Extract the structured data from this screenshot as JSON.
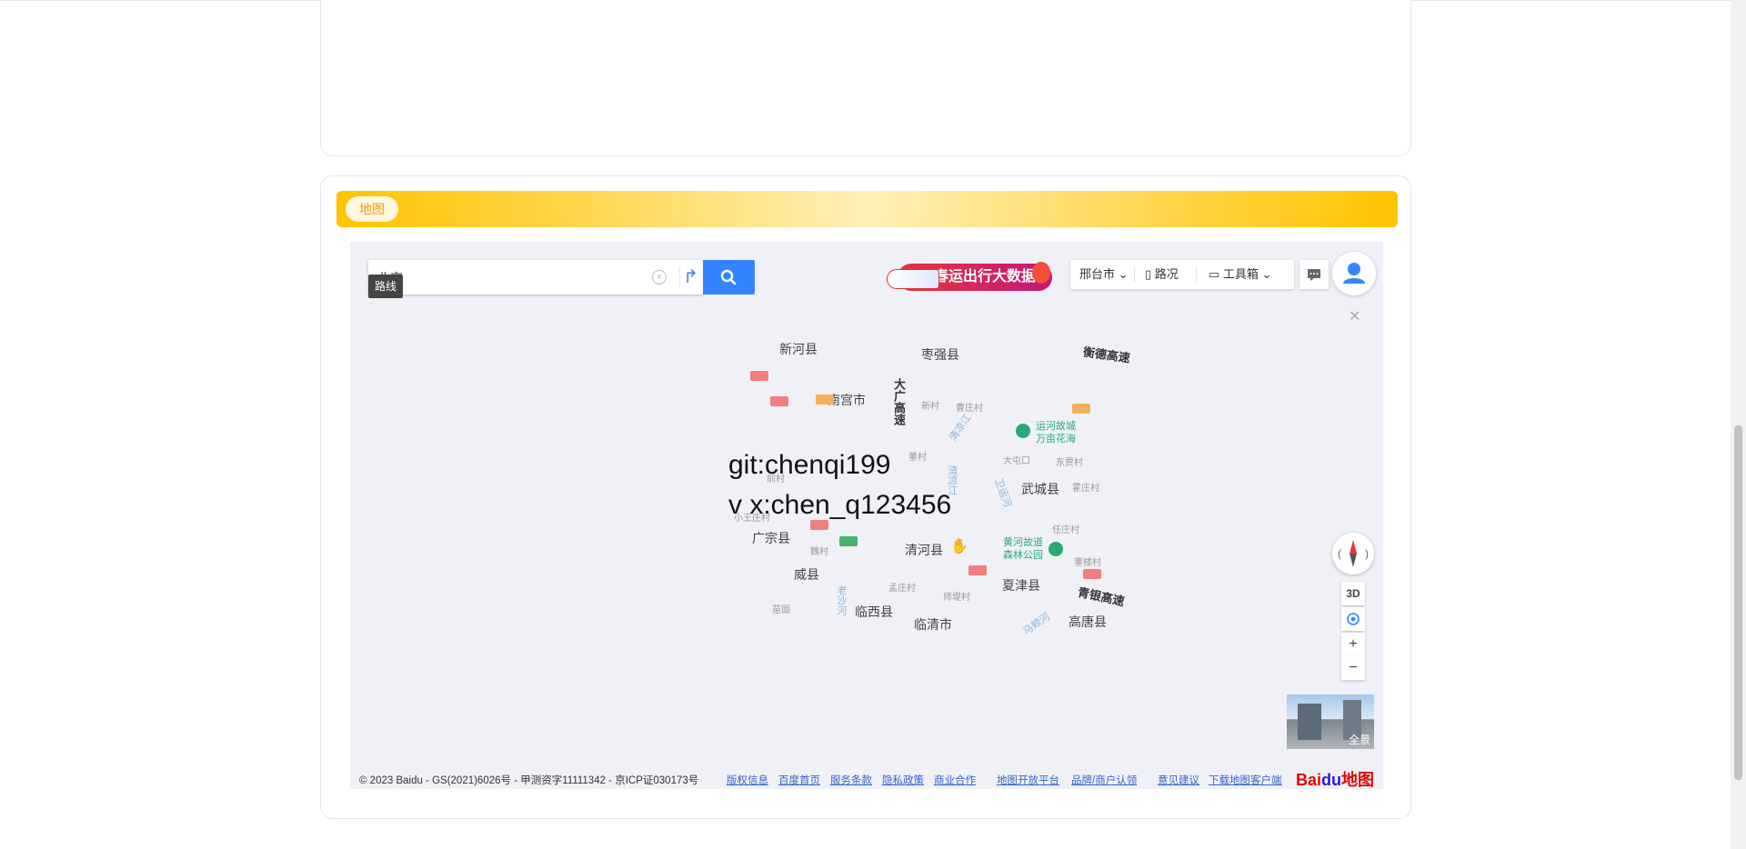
{
  "section": {
    "tag_label": "地图"
  },
  "map": {
    "search": {
      "value": "北京",
      "clear_icon": "close-circle-icon",
      "route_icon": "route-arrow-icon",
      "search_icon": "search-icon"
    },
    "tooltip": "路线",
    "promo": {
      "text": "春运出行大数据"
    },
    "toolbar": {
      "city": "邢台市",
      "traffic": "路况",
      "tools": "工具箱",
      "message_icon": "message-icon"
    },
    "avatar_icon": "user-icon",
    "places": [
      "新河县",
      "枣强县",
      "南宫市",
      "武城县",
      "广宗县",
      "清河县",
      "威县",
      "夏津县",
      "临西县",
      "临清市",
      "高唐县"
    ],
    "villages": [
      "新村",
      "曹庄村",
      "董村",
      "大屯口",
      "东贾村",
      "霍庄村",
      "前村",
      "小王庄村",
      "魏村",
      "任庄村",
      "董楼村",
      "孟庄村",
      "师堤村",
      "苗固"
    ],
    "roads": [
      "衡德高速",
      "大广高速",
      "青银高速"
    ],
    "rivers": [
      "清凉江",
      "清凉江",
      "卫运河",
      "老沙河",
      "马颊河"
    ],
    "parks": [
      {
        "name": "运河故城\n万亩花海"
      },
      {
        "name": "黄河故道\n森林公园"
      }
    ],
    "watermark": [
      "git:chenqi199",
      "v x:chen_q123456"
    ],
    "controls": {
      "three_d": "3D",
      "locate_icon": "locate-icon",
      "zoom_in": "+",
      "zoom_out": "−",
      "compass_icon": "compass-icon"
    },
    "panorama_label": "全景",
    "copyright": "© 2023 Baidu - GS(2021)6026号 - 甲测资字11111342 - 京ICP证030173号",
    "footer_links": [
      "版权信息",
      "百度首页",
      "服务条款",
      "隐私政策",
      "商业合作",
      "地图开放平台",
      "品牌/商户认领",
      "意见建议",
      "下载地图客户端"
    ],
    "logo": {
      "brand": "Bai",
      "du": "du",
      "suffix": "地图"
    }
  }
}
